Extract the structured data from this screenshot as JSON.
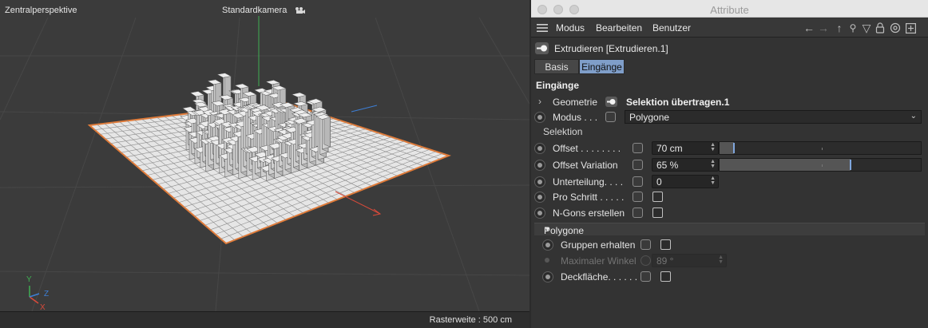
{
  "viewport": {
    "title": "Zentralperspektive",
    "camera": "Standardkamera",
    "status": "Rasterweite : 500 cm",
    "axis_labels": {
      "y": "Y",
      "z": "Z",
      "x": "X"
    },
    "colors": {
      "background": "#3b3b3b",
      "outline": "#e07b39",
      "axis_x": "#d94a3a",
      "axis_y": "#3fae52",
      "axis_z": "#3d7fd6"
    }
  },
  "window": {
    "title": "Attribute"
  },
  "menu": {
    "items": [
      "Modus",
      "Bearbeiten",
      "Benutzer"
    ],
    "icons": [
      "arrow-left-icon",
      "arrow-right-icon",
      "arrow-up-icon",
      "search-icon",
      "filter-icon",
      "lock-icon",
      "target-icon",
      "new-window-icon"
    ]
  },
  "object": {
    "name": "Extrudieren [Extrudieren.1]"
  },
  "tabs": [
    {
      "label": "Basis",
      "active": false
    },
    {
      "label": "Eingänge",
      "active": true
    }
  ],
  "section": {
    "title": "Eingänge",
    "geometrie_label": "Geometrie",
    "geometrie_value": "Selektion übertragen.1",
    "modus_label": "Modus . . .",
    "modus_value": "Polygone",
    "selektion_label": "Selektion",
    "offset_label": "Offset . . . . . . . .",
    "offset_value": "70 cm",
    "offset_slider": 0.07,
    "offset_variation_label": "Offset Variation",
    "offset_variation_value": "65 %",
    "offset_variation_slider": 0.65,
    "unterteilung_label": "Unterteilung. . . .",
    "unterteilung_value": "0",
    "pro_schritt_label": "Pro Schritt . . . . .",
    "pro_schritt_checked": false,
    "ngons_label": "N-Gons erstellen",
    "ngons_checked": false
  },
  "polygone": {
    "header": "Polygone",
    "gruppen_label": "Gruppen erhalten",
    "gruppen_checked": false,
    "winkel_label": "Maximaler Winkel",
    "winkel_value": "89 °",
    "deck_label": "Deckfläche. . . . . .",
    "deck_checked": false
  },
  "colors": {
    "accent": "#7f9ec9",
    "slider_handle": "#7fa6dd",
    "panel_bg": "#333333"
  }
}
